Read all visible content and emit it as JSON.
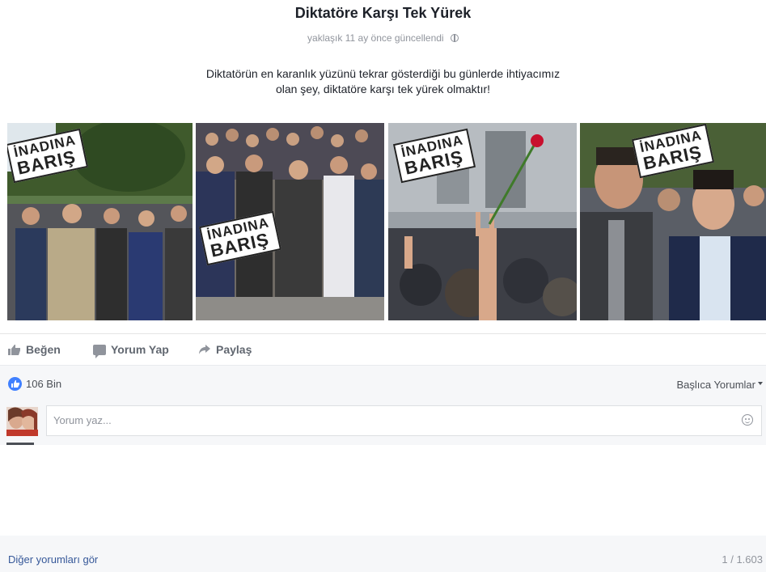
{
  "post": {
    "title": "Diktatöre Karşı Tek Yürek",
    "updated": "yaklaşık 11 ay önce güncellendi",
    "description_line1": "Diktatörün en karanlık yüzünü tekrar gösterdiği bu günlerde ihtiyacımız",
    "description_line2": "olan şey, diktatöre karşı tek yürek olmaktır!"
  },
  "photos": [
    {
      "badge_line1": "İNADINA",
      "badge_line2": "BARIŞ"
    },
    {
      "badge_line1": "İNADINA",
      "badge_line2": "BARIŞ"
    },
    {
      "badge_line1": "İNADINA",
      "badge_line2": "BARIŞ"
    },
    {
      "badge_line1": "İNADINA",
      "badge_line2": "BARIŞ"
    }
  ],
  "actions": {
    "like": "Beğen",
    "comment": "Yorum Yap",
    "share": "Paylaş"
  },
  "reactions": {
    "count": "106 Bin",
    "sort_label": "Başlıca Yorumlar"
  },
  "comment_box": {
    "placeholder": "Yorum yaz..."
  },
  "footer": {
    "more_comments": "Diğer yorumları gör",
    "page_count": "1 / 1.603"
  },
  "colors": {
    "link": "#365899",
    "like_blue": "#4080ff",
    "muted": "#90949c"
  }
}
